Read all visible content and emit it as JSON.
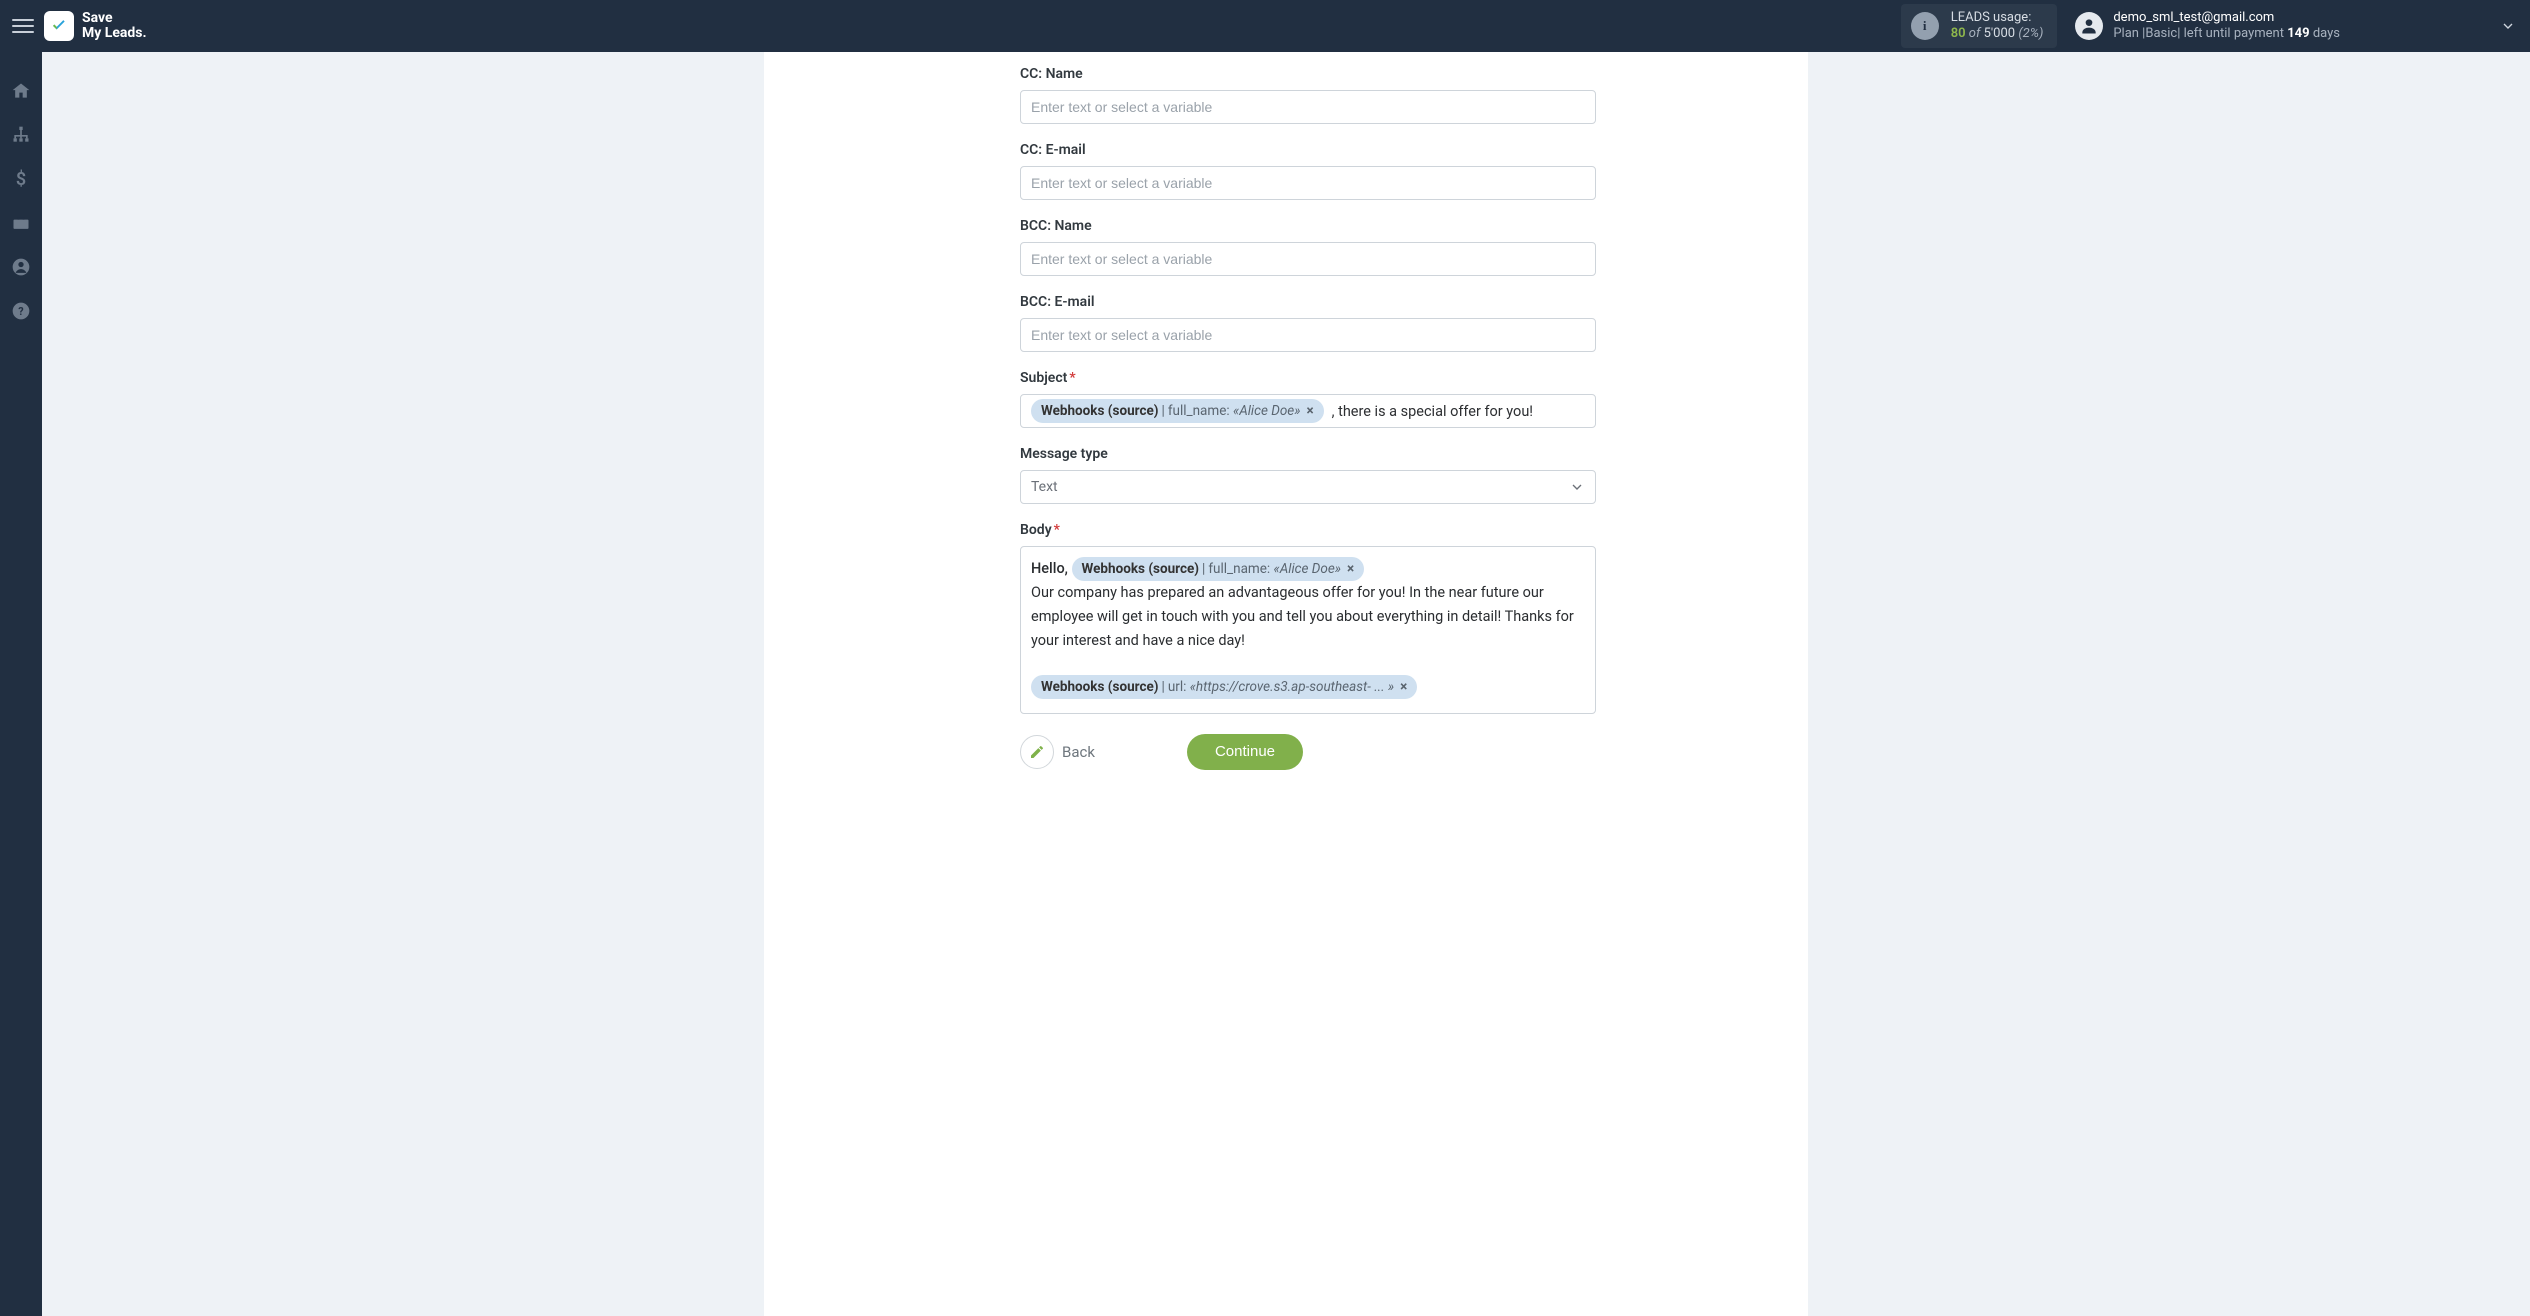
{
  "brand": {
    "line1": "Save",
    "line2": "My Leads."
  },
  "usage": {
    "label": "LEADS usage:",
    "used": "80",
    "of_word": "of",
    "cap": "5'000",
    "pct": "(2%)"
  },
  "user": {
    "email": "demo_sml_test@gmail.com",
    "plan_prefix": "Plan |",
    "plan_name": "Basic",
    "plan_mid": "| left until payment ",
    "days_value": "149",
    "days_suffix": " days"
  },
  "rail": {
    "home": "home-icon",
    "sitemap": "sitemap-icon",
    "billing": "dollar-icon",
    "briefcase": "briefcase-icon",
    "profile": "user-circle-icon",
    "help": "question-circle-icon"
  },
  "fields": {
    "cc_name": {
      "label": "CC: Name",
      "placeholder": "Enter text or select a variable"
    },
    "cc_email": {
      "label": "CC: E-mail",
      "placeholder": "Enter text or select a variable"
    },
    "bcc_name": {
      "label": "BCC: Name",
      "placeholder": "Enter text or select a variable"
    },
    "bcc_email": {
      "label": "BCC: E-mail",
      "placeholder": "Enter text or select a variable"
    },
    "subject": {
      "label": "Subject",
      "chip": {
        "source": "Webhooks (source)",
        "key": "full_name:",
        "value": "«Alice Doe»"
      },
      "after": " , there is a special offer for you!"
    },
    "message_type": {
      "label": "Message type",
      "selected": "Text"
    },
    "body": {
      "label": "Body",
      "hello": "Hello, ",
      "chip_name": {
        "source": "Webhooks (source)",
        "key": "full_name:",
        "value": "«Alice Doe»"
      },
      "paragraph": "Our company has prepared an advantageous offer for you! In the near future our employee will get in touch with you and tell you about everything in detail! Thanks for your interest and have a nice day!",
      "chip_url": {
        "source": "Webhooks (source)",
        "key": "url:",
        "value": "«https://crove.s3.ap-southeast- ... »"
      }
    }
  },
  "actions": {
    "back": "Back",
    "continue": "Continue"
  }
}
